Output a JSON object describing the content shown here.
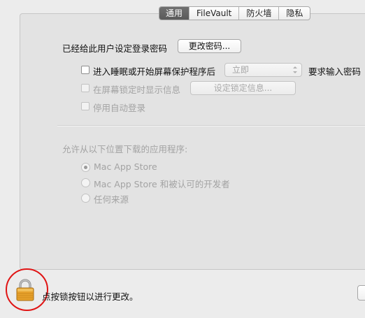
{
  "tabs": [
    {
      "label": "通用",
      "selected": true
    },
    {
      "label": "FileVault",
      "selected": false
    },
    {
      "label": "防火墙",
      "selected": false
    },
    {
      "label": "隐私",
      "selected": false
    }
  ],
  "general": {
    "password_set_label": "已经给此用户设定登录密码",
    "change_password_button": "更改密码...",
    "require_password": {
      "label": "进入睡眠或开始屏幕保护程序后",
      "checked": false,
      "select_value": "立即",
      "suffix": "要求输入密码"
    },
    "show_message": {
      "label": "在屏幕锁定时显示信息",
      "checked": false,
      "button": "设定锁定信息..."
    },
    "disable_autologin": {
      "label": "停用自动登录",
      "checked": false
    }
  },
  "downloads": {
    "heading": "允许从以下位置下载的应用程序:",
    "options": [
      {
        "label": "Mac App Store",
        "selected": true
      },
      {
        "label": "Mac App Store 和被认可的开发者",
        "selected": false
      },
      {
        "label": "任何来源",
        "selected": false
      }
    ]
  },
  "footer": {
    "lock_message": "点按锁按钮以进行更改。",
    "lock_icon": "padlock-icon",
    "highlight_color": "#e01414"
  },
  "colors": {
    "selected_tab": "#5f5f5f",
    "disabled_text": "#a3a3a3",
    "lock_gold": "#e6a12c"
  }
}
